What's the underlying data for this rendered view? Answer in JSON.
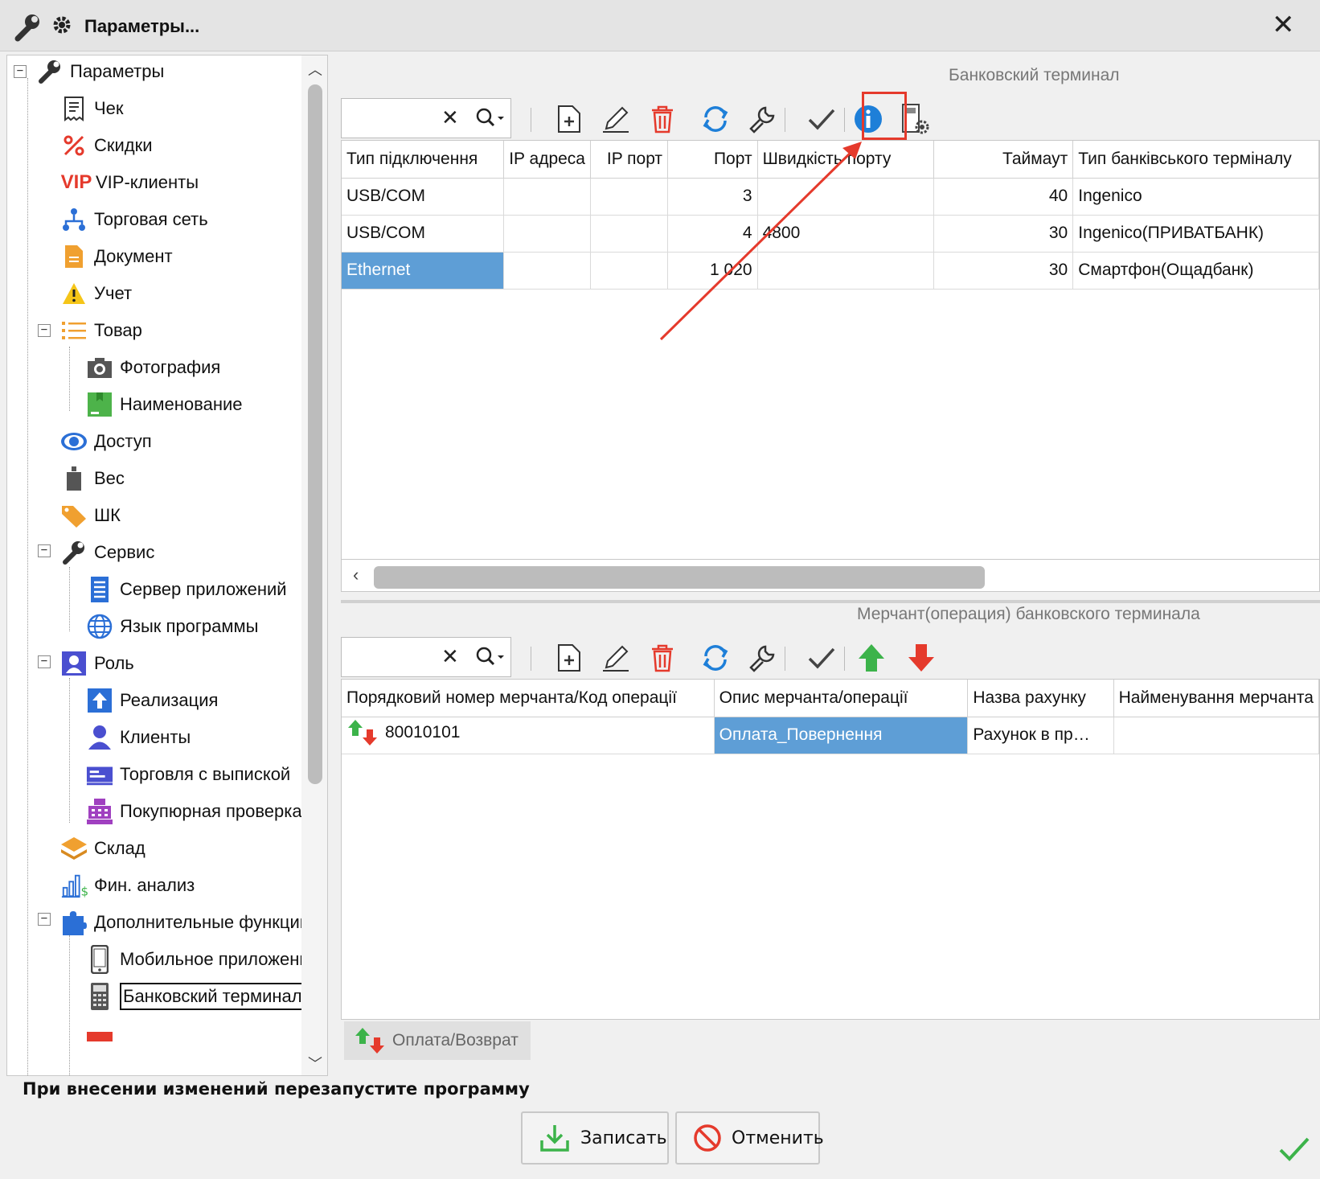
{
  "window": {
    "title": "Параметры..."
  },
  "tree": {
    "items": [
      {
        "label": "Параметры",
        "icon": "wrench-icon"
      },
      {
        "label": "Чек",
        "icon": "receipt-icon"
      },
      {
        "label": "Скидки",
        "icon": "percent-icon"
      },
      {
        "label": "VIP-клиенты",
        "icon": "vip-icon",
        "icon_text": "VIP"
      },
      {
        "label": "Торговая сеть",
        "icon": "network-icon"
      },
      {
        "label": "Документ",
        "icon": "document-icon"
      },
      {
        "label": "Учет",
        "icon": "warning-icon"
      },
      {
        "label": "Товар",
        "icon": "list-icon"
      },
      {
        "label": "Фотография",
        "icon": "camera-icon"
      },
      {
        "label": "Наименование",
        "icon": "name-tag-icon"
      },
      {
        "label": "Доступ",
        "icon": "eye-icon"
      },
      {
        "label": "Вес",
        "icon": "weight-icon"
      },
      {
        "label": "ШК",
        "icon": "tag-icon"
      },
      {
        "label": "Сервис",
        "icon": "wrench-icon"
      },
      {
        "label": "Сервер приложений",
        "icon": "server-icon"
      },
      {
        "label": "Язык программы",
        "icon": "globe-icon"
      },
      {
        "label": "Роль",
        "icon": "user-card-icon"
      },
      {
        "label": "Реализация",
        "icon": "upload-icon"
      },
      {
        "label": "Клиенты",
        "icon": "user-icon"
      },
      {
        "label": "Торговля с выпиской",
        "icon": "printer-icon"
      },
      {
        "label": "Покупюрная проверка",
        "icon": "cash-register-icon"
      },
      {
        "label": "Склад",
        "icon": "layers-icon"
      },
      {
        "label": "Фин. анализ",
        "icon": "chart-dollar-icon"
      },
      {
        "label": "Дополнительные функции",
        "icon": "puzzle-icon"
      },
      {
        "label": "Мобильное приложение",
        "icon": "phone-icon"
      },
      {
        "label": "Банковский терминал",
        "icon": "pos-terminal-icon"
      }
    ]
  },
  "terminal": {
    "section_title": "Банковский терминал",
    "columns": [
      "Тип підключення",
      "IP адреса",
      "IP порт",
      "Порт",
      "Швидкість порту",
      "Таймаут",
      "Тип банківського терміналу"
    ],
    "rows": [
      [
        "USB/COM",
        "",
        "",
        "3",
        "",
        "40",
        "Ingenico"
      ],
      [
        "USB/COM",
        "",
        "",
        "4",
        "4800",
        "30",
        "Ingenico(ПРИВАТБАНК)"
      ],
      [
        "Ethernet",
        "",
        "",
        "1 020",
        "",
        "30",
        "Смартфон(Ощадбанк)"
      ]
    ]
  },
  "merchant": {
    "section_title": "Мерчант(операция) банковского терминала",
    "columns": [
      "Порядковий номер мерчанта/Код операції",
      "Опис мерчанта/операції",
      "Назва рахунку",
      "Найменування мерчанта"
    ],
    "rows": [
      [
        "80010101",
        "Оплата_Повернення",
        "Рахунок в пр…",
        ""
      ]
    ],
    "footer_tab": "Оплата/Возврат"
  },
  "footer": {
    "notice": "При внесении изменений перезапустите программу",
    "save_label": "Записать",
    "cancel_label": "Отменить"
  },
  "colors": {
    "selection": "#5e9ed6",
    "highlight_box": "#e53a2c",
    "accent_blue": "#1e7fd8",
    "delete_red": "#e53a2c",
    "up_green": "#3cb34a"
  }
}
